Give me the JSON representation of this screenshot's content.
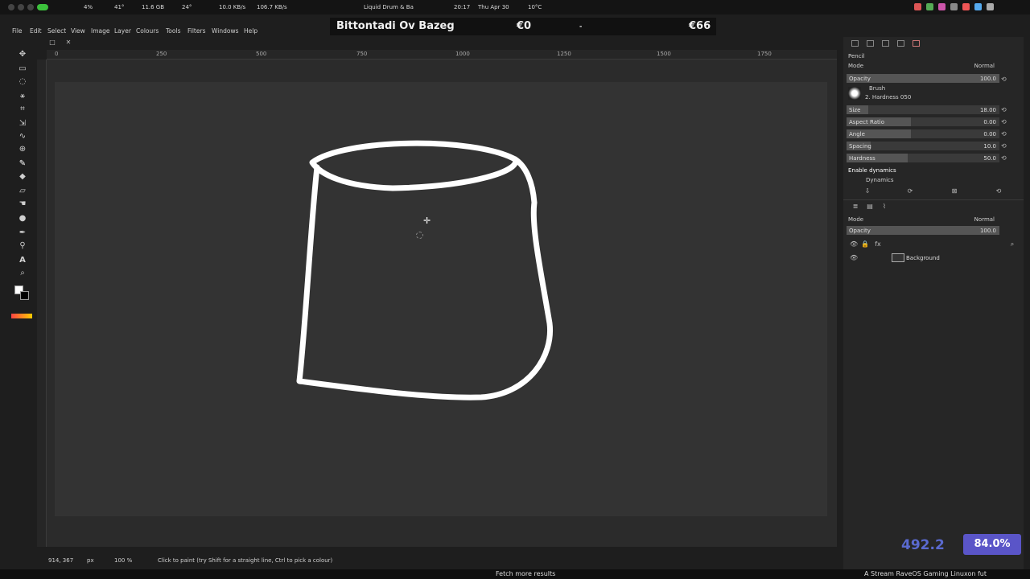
{
  "system_bar": {
    "cpu": "4%",
    "temp": "41°",
    "memory": "11.6 GB",
    "temp2": "24°",
    "net_down": "10.0 KB/s",
    "net_up": "106.7 KB/s",
    "media": "Liquid Drum & Ba",
    "time": "20:17",
    "date": "Thu Apr 30",
    "weather": "10°C"
  },
  "overlay": {
    "title": "Bittontadi Ov Bazeg",
    "value1": "€0",
    "sep": "-",
    "value2": "€66"
  },
  "menu": [
    "File",
    "Edit",
    "Select",
    "View",
    "Image",
    "Layer",
    "Colours",
    "Tools",
    "Filters",
    "Windows",
    "Help"
  ],
  "ruler": {
    "ticks": [
      "0",
      "250",
      "500",
      "750",
      "1000",
      "1250",
      "1500",
      "1750"
    ]
  },
  "tool_options": {
    "tool_name": "Pencil",
    "mode_label": "Mode",
    "mode_value": "Normal",
    "opacity_label": "Opacity",
    "opacity_value": "100.0",
    "brush_label": "Brush",
    "brush_name": "2. Hardness 050",
    "size_label": "Size",
    "size_value": "18.00",
    "aspect_label": "Aspect Ratio",
    "aspect_value": "0.00",
    "angle_label": "Angle",
    "angle_value": "0.00",
    "spacing_label": "Spacing",
    "spacing_value": "10.0",
    "hardness_label": "Hardness",
    "hardness_value": "50.0",
    "dynamics_toggle": "Enable dynamics",
    "dynamics_label": "Dynamics",
    "hardness_fraction": 0.4
  },
  "layers": {
    "mode_label": "Mode",
    "mode_value": "Normal",
    "opacity_label": "Opacity",
    "opacity_value": "100.0",
    "fx_label": "fx",
    "items": [
      {
        "name": "Background"
      }
    ]
  },
  "status": {
    "coords": "914, 367",
    "unit": "px",
    "zoom": "100 %",
    "hint": "Click to paint (try Shift for a straight line, Ctrl to pick a colour)"
  },
  "stream": {
    "big_stat": "492.2",
    "pill": "84.0%",
    "fetch": "Fetch more results",
    "ticker": "A Stream RaveOS Gaming Linuxon fut"
  }
}
